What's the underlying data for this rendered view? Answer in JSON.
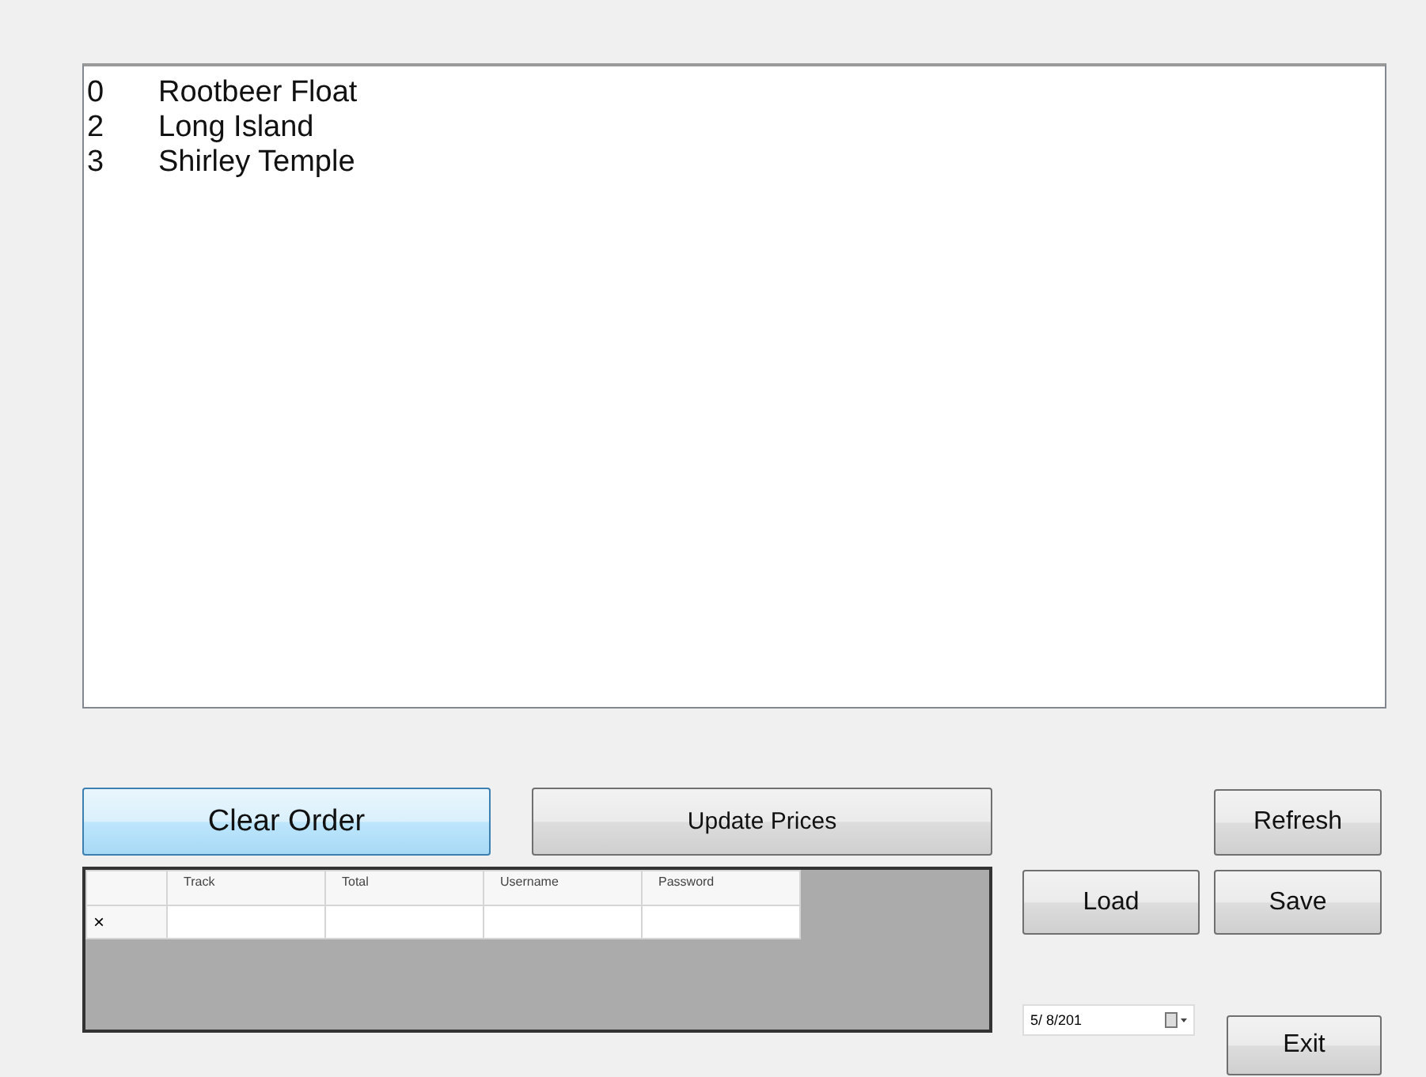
{
  "order_list": [
    {
      "number": "0",
      "name": "Rootbeer Float"
    },
    {
      "number": "2",
      "name": "Long Island"
    },
    {
      "number": "3",
      "name": "Shirley Temple"
    }
  ],
  "buttons": {
    "clear_order": {
      "label": "Clear Order",
      "focused": true
    },
    "update_prices": "Update Prices",
    "refresh": "Refresh",
    "load": "Load",
    "save": "Save",
    "exit": "Exit"
  },
  "grid": {
    "columns": [
      "Track",
      "Total",
      "Username",
      "Password"
    ],
    "new_row_marker": "×"
  },
  "date_picker": {
    "value": "5/ 8/201"
  }
}
